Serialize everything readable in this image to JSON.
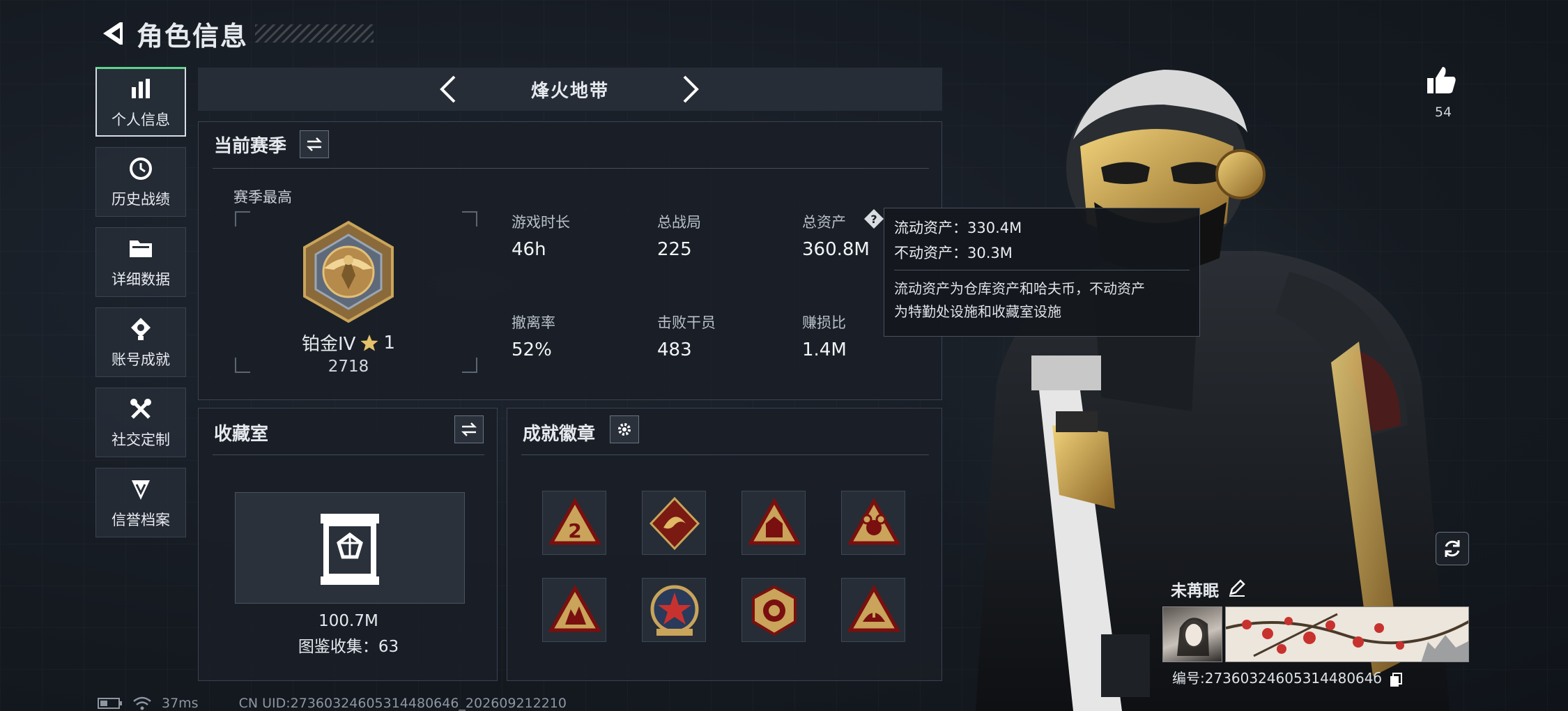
{
  "header": {
    "title": "角色信息",
    "back_icon": "back-arrow-icon"
  },
  "sidebar": {
    "items": [
      {
        "label": "个人信息",
        "icon": "bar-chart-icon",
        "active": true
      },
      {
        "label": "历史战绩",
        "icon": "history-icon",
        "active": false
      },
      {
        "label": "详细数据",
        "icon": "folder-icon",
        "active": false
      },
      {
        "label": "账号成就",
        "icon": "achievement-icon",
        "active": false
      },
      {
        "label": "社交定制",
        "icon": "tools-icon",
        "active": false
      },
      {
        "label": "信誉档案",
        "icon": "shield-icon",
        "active": false
      }
    ]
  },
  "mode": {
    "title": "烽火地带"
  },
  "season": {
    "title": "当前赛季",
    "best_label": "赛季最高",
    "rank_name": "铂金IV",
    "rank_star_count": "1",
    "rank_score": "2718",
    "stats": [
      {
        "label": "游戏时长",
        "value": "46h"
      },
      {
        "label": "总战局",
        "value": "225"
      },
      {
        "label": "总资产",
        "value": "360.8M"
      },
      {
        "label": "撤离率",
        "value": "52%"
      },
      {
        "label": "击败干员",
        "value": "483"
      },
      {
        "label": "赚损比",
        "value": "1.4M"
      }
    ]
  },
  "tooltip": {
    "line1": "流动资产：330.4M",
    "line2": "不动资产：30.3M",
    "desc1": "流动资产为仓库资产和哈夫币，不动资产",
    "desc2": "为特勤处设施和收藏室设施"
  },
  "collection": {
    "title": "收藏室",
    "value": "100.7M",
    "catalog": "图鉴收集：63"
  },
  "badges": {
    "title": "成就徽章",
    "items": [
      "badge-icon",
      "badge-icon",
      "badge-icon",
      "badge-icon",
      "badge-icon",
      "badge-icon",
      "badge-icon",
      "badge-icon"
    ]
  },
  "likes": {
    "count": "54"
  },
  "player": {
    "name": "未苒眠",
    "id": "编号:2736032460531448064б"
  },
  "status": {
    "ping": "37ms",
    "uid": "CN UID:27360324605314480646_202609212210"
  },
  "colors": {
    "gold": "#c9a45a",
    "accent_green": "#5fd18c",
    "panel": "#1a1f27"
  }
}
